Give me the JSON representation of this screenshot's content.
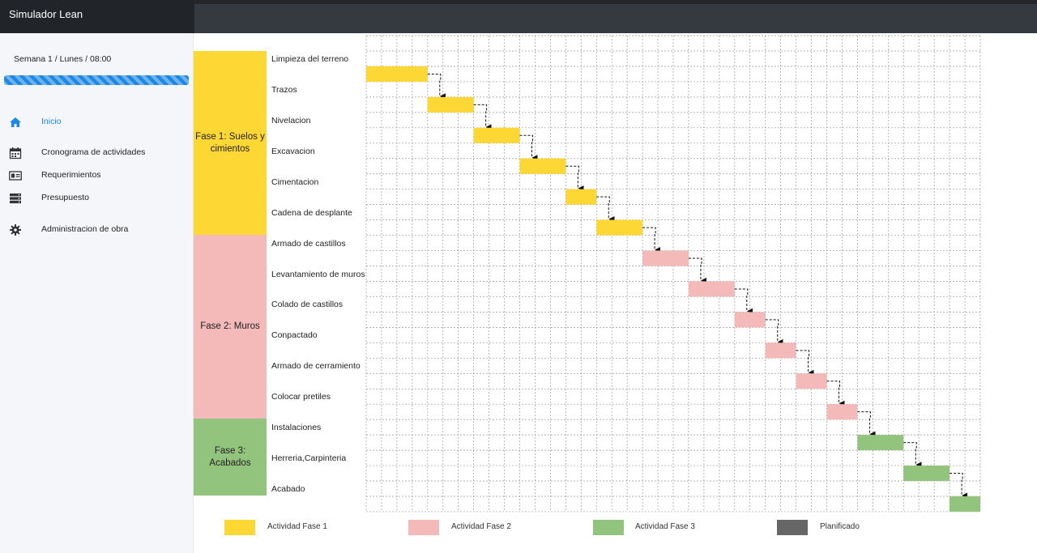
{
  "app": {
    "title": "Simulador Lean"
  },
  "sidebar": {
    "week_label": "Semana 1 / Lunes / 08:00",
    "progress_percent": 100,
    "items": [
      {
        "label": "Inicio",
        "icon": "home-icon",
        "active": true
      },
      {
        "label": "Cronograma de actividades",
        "icon": "calendar-icon",
        "active": false
      },
      {
        "label": "Requerimientos",
        "icon": "id-card-icon",
        "active": false
      },
      {
        "label": "Presupuesto",
        "icon": "server-icon",
        "active": false
      },
      {
        "label": "Administracion de obra",
        "icon": "gear-icon",
        "active": false
      }
    ]
  },
  "colors": {
    "fase1": "#fdd835",
    "fase2": "#f4b9b9",
    "fase3": "#93c47d",
    "planificado": "#666666",
    "accent": "#1e88e5"
  },
  "phases": [
    {
      "label": "Fase 1: Suelos y cimientos",
      "color_key": "fase1"
    },
    {
      "label": "Fase 2: Muros",
      "color_key": "fase2"
    },
    {
      "label": "Fase 3: Acabados",
      "color_key": "fase3"
    }
  ],
  "chart_data": {
    "type": "gantt",
    "tasks": [
      {
        "name": "Limpieza del terreno",
        "phase": 1,
        "start": 0,
        "duration": 4
      },
      {
        "name": "Trazos",
        "phase": 1,
        "start": 4,
        "duration": 3
      },
      {
        "name": "Nivelacion",
        "phase": 1,
        "start": 7,
        "duration": 3
      },
      {
        "name": "Excavacion",
        "phase": 1,
        "start": 10,
        "duration": 3
      },
      {
        "name": "Cimentacion",
        "phase": 1,
        "start": 13,
        "duration": 2
      },
      {
        "name": "Cadena de desplante",
        "phase": 1,
        "start": 15,
        "duration": 3
      },
      {
        "name": "Armado de castillos",
        "phase": 2,
        "start": 18,
        "duration": 3
      },
      {
        "name": "Levantamiento de muros",
        "phase": 2,
        "start": 21,
        "duration": 3
      },
      {
        "name": "Colado de castillos",
        "phase": 2,
        "start": 24,
        "duration": 2
      },
      {
        "name": "Conpactado",
        "phase": 2,
        "start": 26,
        "duration": 2
      },
      {
        "name": "Armado de cerramiento",
        "phase": 2,
        "start": 28,
        "duration": 2
      },
      {
        "name": "Colocar pretiles",
        "phase": 2,
        "start": 30,
        "duration": 2
      },
      {
        "name": "Instalaciones",
        "phase": 3,
        "start": 32,
        "duration": 3
      },
      {
        "name": "Herreria,Carpinteria",
        "phase": 3,
        "start": 35,
        "duration": 3
      },
      {
        "name": "Acabado",
        "phase": 3,
        "start": 38,
        "duration": 2
      }
    ],
    "total_units": 40,
    "dependencies": "sequential",
    "grid": true
  },
  "legend": [
    {
      "label": "Actividad Fase 1",
      "color_key": "fase1"
    },
    {
      "label": "Actividad Fase 2",
      "color_key": "fase2"
    },
    {
      "label": "Actividad Fase 3",
      "color_key": "fase3"
    },
    {
      "label": "Planificado",
      "color_key": "planificado"
    }
  ]
}
